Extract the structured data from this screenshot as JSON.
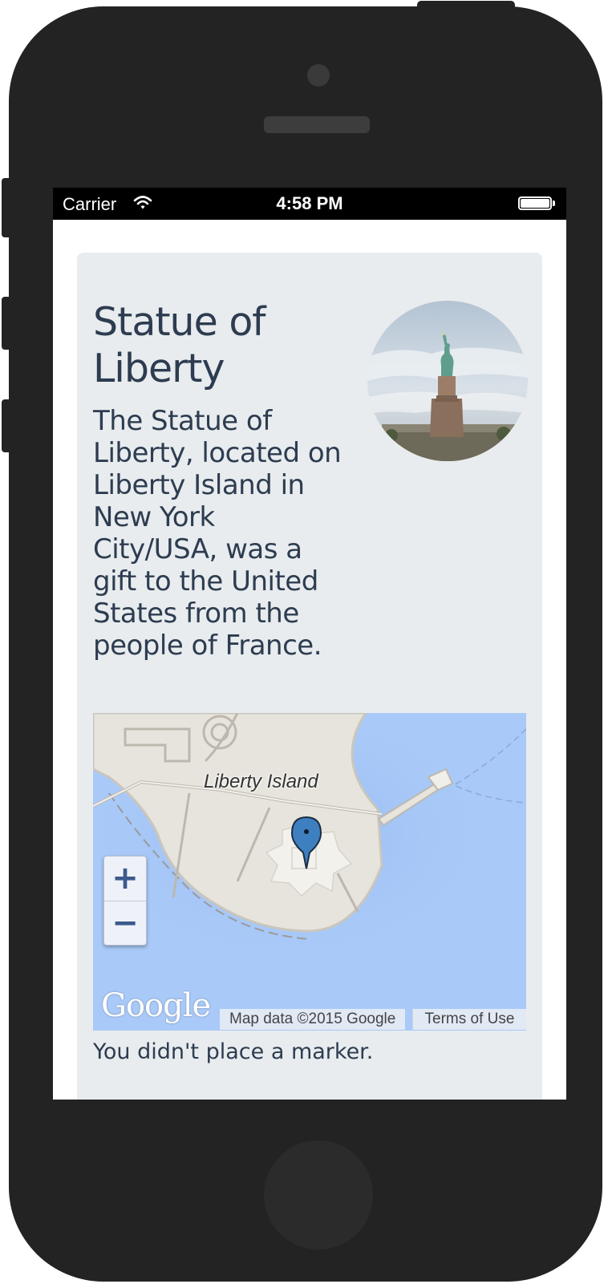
{
  "status_bar": {
    "carrier": "Carrier",
    "time": "4:58 PM"
  },
  "place": {
    "title": "Statue of Liberty",
    "description": "The Statue of Liberty, located on Liberty Island in New York City/USA, was a gift to the United States from the people of France.",
    "image_icon": "statue-of-liberty-photo"
  },
  "map": {
    "label": "Liberty Island",
    "zoom_in": "+",
    "zoom_out": "−",
    "logo": "Google",
    "attribution": "Map data ©2015 Google",
    "terms": "Terms of Use",
    "marker_icon": "map-pin-icon"
  },
  "message": "You didn't place a marker.",
  "colors": {
    "card_bg": "#e8ecee",
    "text": "#2d3c50",
    "water": "#a9c9f8",
    "land": "#e7e4dd",
    "marker": "#3e7fbf"
  }
}
